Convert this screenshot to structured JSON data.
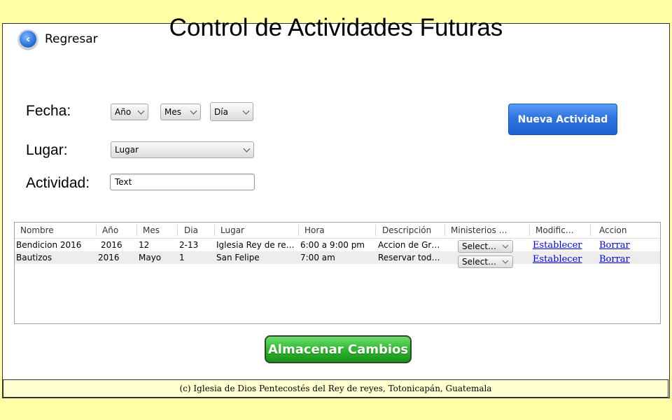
{
  "page": {
    "title": "Control de Actividades Futuras"
  },
  "nav": {
    "back_label": "Regresar",
    "back_icon": "chevron-left-icon"
  },
  "form": {
    "fecha_label": "Fecha:",
    "lugar_label": "Lugar:",
    "actividad_label": "Actividad:",
    "anio_select": "Año",
    "mes_select": "Mes",
    "dia_select": "Día",
    "lugar_select": "Lugar",
    "actividad_value": "Text"
  },
  "actions": {
    "nueva_actividad": "Nueva Actividad",
    "almacenar": "Almacenar Cambios"
  },
  "table": {
    "columns": [
      "Nombre",
      "Año",
      "Mes",
      "Dia",
      "Lugar",
      "Hora",
      "Descripción",
      "Ministerios O…",
      "Modific…",
      "Accion"
    ],
    "rows": [
      {
        "nombre": "Bendicion 2016",
        "anio": "2016",
        "mes": "12",
        "dia": "2-13",
        "lugar": "Iglesia Rey de re…",
        "hora": "6:00 a 9:00 pm",
        "descripcion": "Accion de Gr…",
        "ministerio": "Select…",
        "modificar": "Establecer",
        "accion": "Borrar"
      },
      {
        "nombre": "Bautizos",
        "anio": "2016",
        "mes": "Mayo",
        "dia": "1",
        "lugar": "San Felipe",
        "hora": "7:00 am",
        "descripcion": "Reservar todo…",
        "ministerio": "Select…",
        "modificar": "Establecer",
        "accion": "Borrar"
      }
    ]
  },
  "footer": {
    "text": "(c) Iglesia de Dios Pentecostés del Rey de reyes, Totonicapán, Guatemala"
  },
  "colors": {
    "page_bg": "#ffffa8",
    "primary_button": "#2f73e0",
    "save_button": "#2fb92f",
    "link": "#0000ee"
  }
}
